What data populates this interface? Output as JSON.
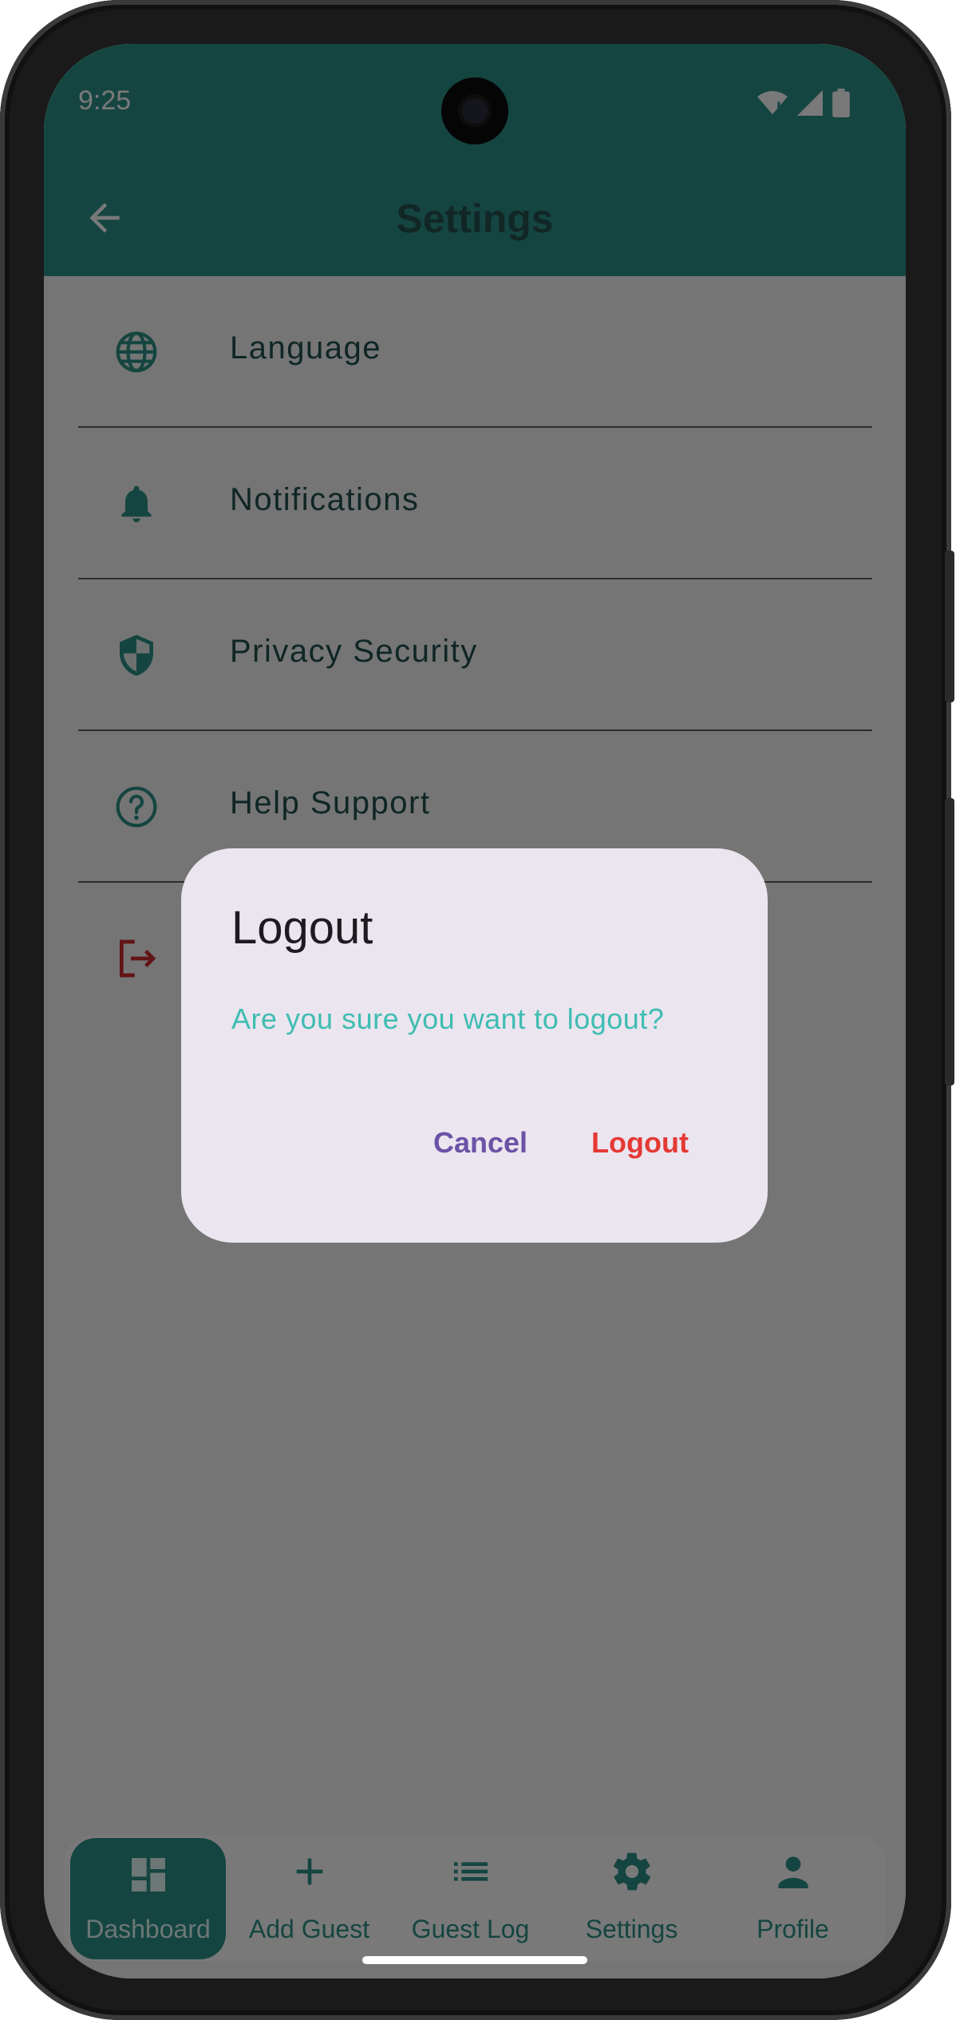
{
  "status_bar": {
    "time": "9:25"
  },
  "header": {
    "title": "Settings"
  },
  "settings_list": [
    {
      "label": "Language",
      "icon": "globe-icon"
    },
    {
      "label": "Notifications",
      "icon": "bell-icon"
    },
    {
      "label": "Privacy Security",
      "icon": "shield-icon"
    },
    {
      "label": "Help Support",
      "icon": "help-circle-icon"
    },
    {
      "label": "",
      "icon": "logout-icon"
    }
  ],
  "dialog": {
    "title": "Logout",
    "message": "Are you sure you want to logout?",
    "cancel_label": "Cancel",
    "confirm_label": "Logout"
  },
  "bottom_nav": [
    {
      "label": "Dashboard",
      "icon": "dashboard-icon",
      "active": true
    },
    {
      "label": "Add Guest",
      "icon": "plus-icon",
      "active": false
    },
    {
      "label": "Guest Log",
      "icon": "list-icon",
      "active": false
    },
    {
      "label": "Settings",
      "icon": "gear-icon",
      "active": false
    },
    {
      "label": "Profile",
      "icon": "person-icon",
      "active": false
    }
  ],
  "colors": {
    "primary": "#2a8a83",
    "dialog_background": "#ebe5ef",
    "dialog_message": "#3fbdb2",
    "cancel": "#6b52a6",
    "logout": "#e53935",
    "logout_icon": "#c62828"
  }
}
